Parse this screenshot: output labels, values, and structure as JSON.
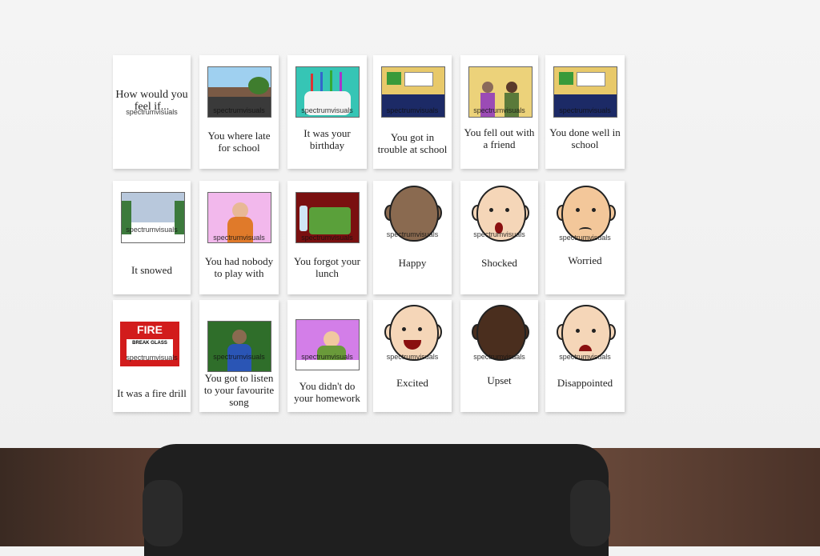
{
  "watermark": "spectrumvisuals",
  "cards": {
    "c1": {
      "label": "How would you feel if..."
    },
    "c2": {
      "label": "You where late for school"
    },
    "c3": {
      "label": "It was your birthday"
    },
    "c4": {
      "label": "You got in trouble at school"
    },
    "c5": {
      "label": "You fell out with a friend"
    },
    "c6": {
      "label": "You done well in school"
    },
    "c7": {
      "label": "It snowed"
    },
    "c8": {
      "label": "You had nobody to play with"
    },
    "c9": {
      "label": "You forgot your lunch"
    },
    "c10": {
      "label": "Happy"
    },
    "c11": {
      "label": "Shocked"
    },
    "c12": {
      "label": "Worried"
    },
    "c13": {
      "label": "It was a fire drill",
      "sign_title": "FIRE",
      "sign_sub": "BREAK GLASS"
    },
    "c14": {
      "label": "You got to listen to your favourite song"
    },
    "c15": {
      "label": "You didn't do your homework"
    },
    "c16": {
      "label": "Excited"
    },
    "c17": {
      "label": "Upset"
    },
    "c18": {
      "label": "Disappointed"
    }
  }
}
